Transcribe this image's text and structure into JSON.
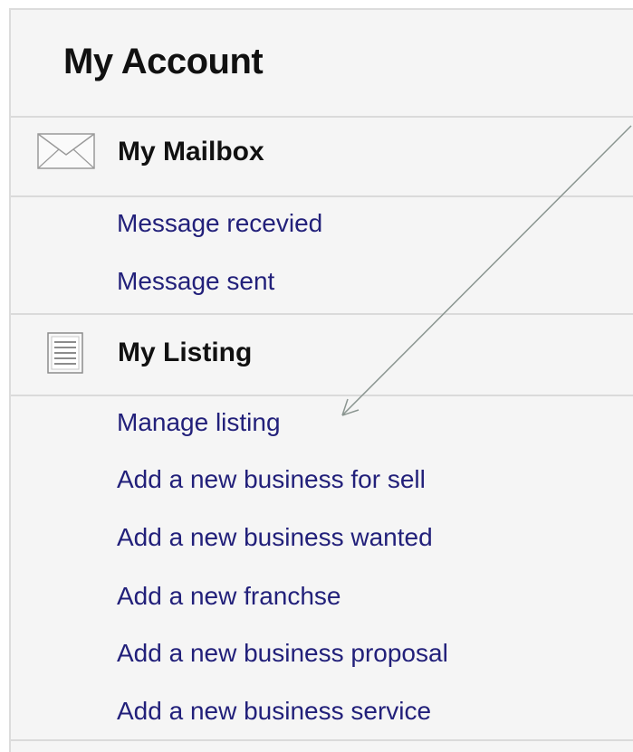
{
  "account_panel": {
    "title": "My Account",
    "mailbox": {
      "label": "My Mailbox",
      "icon": "envelope-icon",
      "links": [
        "Message recevied",
        "Message sent"
      ]
    },
    "listing": {
      "label": "My Listing",
      "icon": "list-icon",
      "links": [
        "Manage listing",
        "Add a new business for sell",
        "Add a new business wanted",
        "Add a new franchse",
        "Add a new business proposal",
        "Add a new business service"
      ]
    }
  },
  "colors": {
    "panel_background": "#f5f5f5",
    "link": "#22207a",
    "heading": "#111111",
    "divider": "#dadada",
    "annotation_arrow": "#8a9590"
  }
}
